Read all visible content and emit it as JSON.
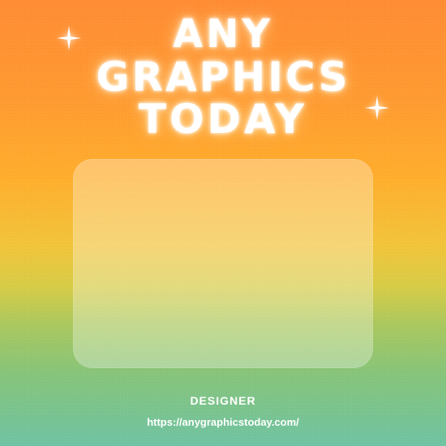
{
  "poster": {
    "title_lines": [
      "ANY",
      "GRAPHICS",
      "TODAY"
    ],
    "role": "DESIGNER",
    "url": "https://anygraphicstoday.com/"
  },
  "icons": {
    "left_sparkle": "sparkle-icon",
    "right_sparkle": "sparkle-icon"
  },
  "colors": {
    "gradient_top": "#ff8c33",
    "gradient_middle": "#f2c43a",
    "gradient_bottom": "#6fc3a3",
    "text": "#ffffff"
  }
}
